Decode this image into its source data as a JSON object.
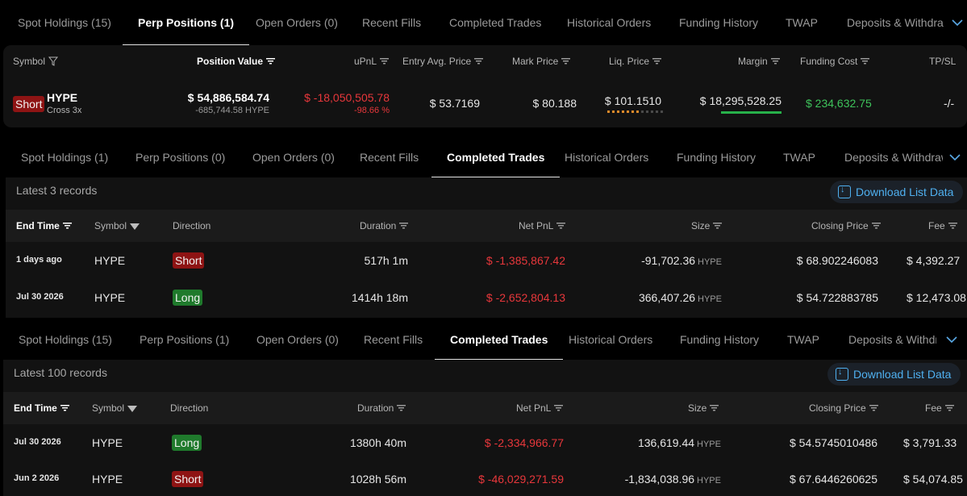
{
  "panel1": {
    "tabs": [
      "Spot Holdings (15)",
      "Perp Positions (1)",
      "Open Orders (0)",
      "Recent Fills",
      "Completed Trades",
      "Historical Orders",
      "Funding History",
      "TWAP",
      "Deposits & Withdra"
    ],
    "columns": {
      "symbol": "Symbol",
      "position_value": "Position Value",
      "upnl": "uPnL",
      "entry": "Entry Avg. Price",
      "mark": "Mark Price",
      "liq": "Liq. Price",
      "margin": "Margin",
      "funding": "Funding Cost",
      "tpsl": "TP/SL"
    },
    "row": {
      "direction": "Short",
      "symbol": "HYPE",
      "leverage": "Cross 3x",
      "position_value": "$ 54,886,584.74",
      "position_size": "-685,744.58 HYPE",
      "upnl": "$ -18,050,505.78",
      "upnl_pct": "-98.66 %",
      "entry": "$ 53.7169",
      "mark": "$ 80.188",
      "liq": "$ 101.1510",
      "margin": "$ 18,295,528.25",
      "funding": "$ 234,632.75",
      "tpsl": "-/-"
    },
    "liq_risk_fraction": 0.6,
    "margin_bar_fraction": 1.0
  },
  "panel2": {
    "tabs": [
      "Spot Holdings (1)",
      "Perp Positions (0)",
      "Open Orders (0)",
      "Recent Fills",
      "Completed Trades",
      "Historical Orders",
      "Funding History",
      "TWAP",
      "Deposits & Withdraw"
    ],
    "records": "Latest 3 records",
    "download": "Download List Data",
    "columns": {
      "end_time": "End Time",
      "symbol": "Symbol",
      "direction": "Direction",
      "duration": "Duration",
      "net_pnl": "Net PnL",
      "size": "Size",
      "closing_price": "Closing Price",
      "fee": "Fee"
    },
    "rows": [
      {
        "end_time": "1 days ago",
        "symbol": "HYPE",
        "direction": "Short",
        "duration": "517h 1m",
        "net_pnl": "$ -1,385,867.42",
        "size": "-91,702.36",
        "unit": "HYPE",
        "closing_price": "$ 68.902246083",
        "fee": "$ 4,392.27"
      },
      {
        "end_time": "Jul 30 2026",
        "symbol": "HYPE",
        "direction": "Long",
        "duration": "1414h 18m",
        "net_pnl": "$ -2,652,804.13",
        "size": "366,407.26",
        "unit": "HYPE",
        "closing_price": "$ 54.722883785",
        "fee": "$ 12,473.08"
      }
    ]
  },
  "panel3": {
    "tabs": [
      "Spot Holdings (15)",
      "Perp Positions (1)",
      "Open Orders (0)",
      "Recent Fills",
      "Completed Trades",
      "Historical Orders",
      "Funding History",
      "TWAP",
      "Deposits & Withdra"
    ],
    "records": "Latest 100 records",
    "download": "Download List Data",
    "columns": {
      "end_time": "End Time",
      "symbol": "Symbol",
      "direction": "Direction",
      "duration": "Duration",
      "net_pnl": "Net PnL",
      "size": "Size",
      "closing_price": "Closing Price",
      "fee": "Fee"
    },
    "rows": [
      {
        "end_time": "Jul 30 2026",
        "symbol": "HYPE",
        "direction": "Long",
        "duration": "1380h 40m",
        "net_pnl": "$ -2,334,966.77",
        "size": "136,619.44",
        "unit": "HYPE",
        "closing_price": "$ 54.5745010486",
        "fee": "$ 3,791.33"
      },
      {
        "end_time": "Jun 2 2026",
        "symbol": "HYPE",
        "direction": "Short",
        "duration": "1028h 56m",
        "net_pnl": "$ -46,029,271.59",
        "size": "-1,834,038.96",
        "unit": "HYPE",
        "closing_price": "$ 67.6446260625",
        "fee": "$ 54,074.85"
      }
    ]
  },
  "colors": {
    "negative": "#e8373b",
    "positive": "#3ec35b",
    "accent": "#4fb0f0",
    "short_badge": "#8e1414",
    "long_badge": "#1f7a2c"
  }
}
